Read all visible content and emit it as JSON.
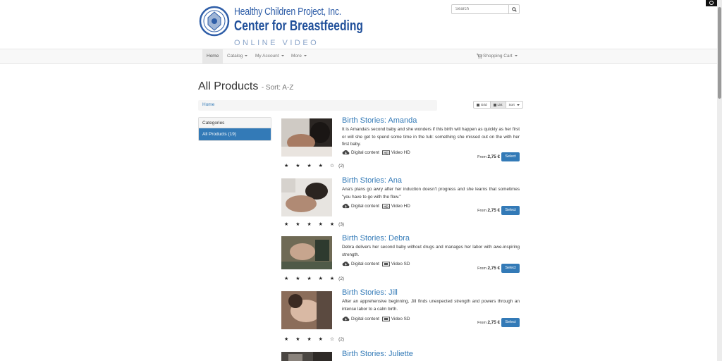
{
  "header": {
    "logo_line1": "Healthy Children Project, Inc.",
    "logo_line2": "Center for Breastfeeding",
    "logo_line3": "ONLINE VIDEO",
    "search_placeholder": "Search"
  },
  "nav": {
    "items": [
      {
        "label": "Home",
        "active": true
      },
      {
        "label": "Catalog"
      },
      {
        "label": "My Account"
      },
      {
        "label": "More"
      }
    ],
    "cart_label": "Shopping Cart"
  },
  "page": {
    "title": "All Products",
    "subtitle": "- Sort: A-Z",
    "breadcrumb": "Home",
    "view_grid": "Grid",
    "view_list": "List",
    "sort": "Sort"
  },
  "sidebar": {
    "heading": "Categories",
    "items": [
      {
        "label": "All Products (19)",
        "active": true
      }
    ]
  },
  "products": [
    {
      "title": "Birth Stories: Amanda",
      "description": "It is Amanda's second baby and she wonders if this birth will happen as quickly as her first or will she get to spend some time in the tub: something she missed out on the with her first baby.",
      "content_type": "Digital content",
      "format": "Video HD",
      "price_prefix": "From",
      "price": "2,75 €",
      "button": "Select",
      "rating": 4,
      "stars": "★ ★ ★ ★ ☆",
      "review_count": "(2)"
    },
    {
      "title": "Birth Stories: Ana",
      "description": "Ana's plans go awry after her induction doesn't progress and she learns that sometimes \"you have to go with the flow.\"",
      "content_type": "Digital content",
      "format": "Video HD",
      "price_prefix": "From",
      "price": "2,75 €",
      "button": "Select",
      "rating": 5,
      "stars": "★ ★ ★ ★ ★",
      "review_count": "(3)"
    },
    {
      "title": "Birth Stories: Debra",
      "description": "Debra delivers her second baby without drugs and manages her labor with awe-inspiring strength.",
      "content_type": "Digital content",
      "format": "Video SD",
      "price_prefix": "From",
      "price": "2,75 €",
      "button": "Select",
      "rating": 5,
      "stars": "★ ★ ★ ★ ★",
      "review_count": "(2)"
    },
    {
      "title": "Birth Stories: Jill",
      "description": "After an apprehensive beginning, Jill finds unexpected strength and powers through an intense labor to a calm birth.",
      "content_type": "Digital content",
      "format": "Video SD",
      "price_prefix": "From",
      "price": "2,75 €",
      "button": "Select",
      "rating": 4,
      "stars": "★ ★ ★ ★ ☆",
      "review_count": "(2)"
    },
    {
      "title": "Birth Stories: Juliette"
    }
  ],
  "colors": {
    "link": "#337ab7",
    "button": "#337ab7",
    "logo_blue": "#1f4f9a"
  }
}
